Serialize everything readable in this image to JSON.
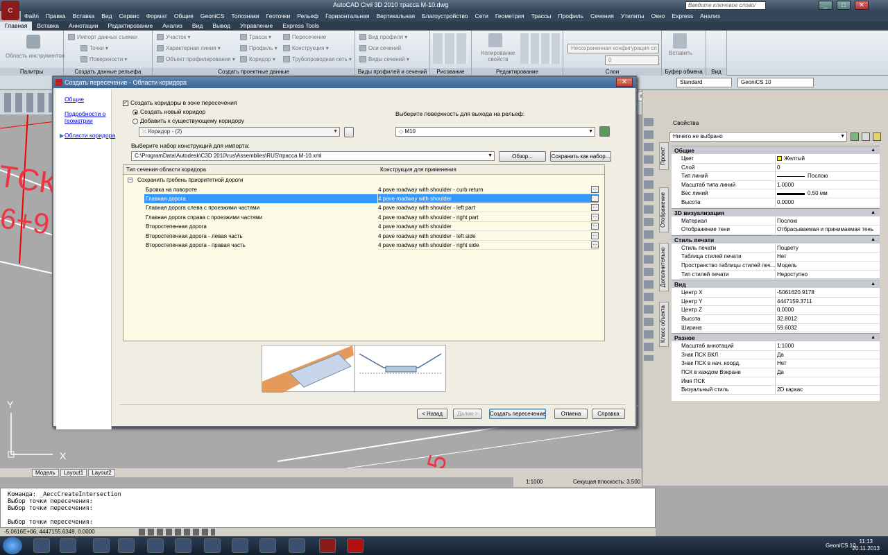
{
  "app": {
    "title": "AutoCAD Civil 3D 2010     трасса M-10.dwg",
    "search_placeholder": "Введите ключевое слово/фразу"
  },
  "menu": [
    "Файл",
    "Правка",
    "Вставка",
    "Вид",
    "Сервис",
    "Формат",
    "Общие",
    "GeoniCS",
    "Топознаки",
    "Геоточки",
    "Рельеф",
    "Горизонтальная",
    "Вертикальная",
    "Благоустройство",
    "Сети",
    "Геометрия",
    "Трассы",
    "Профиль",
    "Сечения",
    "Утилиты",
    "Окно",
    "Express",
    "Анализ"
  ],
  "ribbon_tabs": [
    "Главная",
    "Вставка",
    "Аннотации",
    "Редактирование",
    "Анализ",
    "Вид",
    "Вывод",
    "Управление",
    "Express Tools"
  ],
  "ribbon": {
    "tool_area": "Область инструментов",
    "palettes": "Палитры",
    "create_surface_data": "Создать данные рельефа",
    "import_survey": "Импорт данных съемки",
    "points": "Точки",
    "surfaces": "Поверхности",
    "parcel": "Участок",
    "feature_line": "Характерная линия",
    "grading": "Объект профилирования",
    "alignment": "Трасса",
    "profile": "Профиль",
    "corridor": "Коридор",
    "intersection": "Пересечение",
    "assembly": "Конструкция",
    "pipe_network": "Трубопроводная сеть",
    "create_design_data": "Создать проектные данные",
    "profile_view": "Вид профиля",
    "sample_lines": "Оси сечений",
    "section_views": "Виды сечений",
    "profile_section_views": "Виды профилей и сечений",
    "draw": "Рисование",
    "copy_props": "Копирование свойств",
    "modify": "Редактирование",
    "unsaved_config": "Несохраненная конфигурация сл",
    "layer_zero": "0",
    "layers": "Слои",
    "paste": "Вставить",
    "clipboard": "Буфер обмена",
    "view": "Вид"
  },
  "toolbar": {
    "style1": "Standard",
    "style2": "GeoniCS 10",
    "style3": "ndard"
  },
  "dialog": {
    "title": "Создать пересечение - Области коридора",
    "nav": [
      "Общие",
      "Подробности о геометрии",
      "Области коридора"
    ],
    "create_corridors_label": "Создать коридоры в зоне пересечения",
    "new_corridor_label": "Создать новый коридор",
    "add_existing_label": "Добавить к существующему коридору",
    "corridor_value": "Коридор - (2)",
    "surface_label": "Выберите поверхность для выхода на рельеф:",
    "surface_value": "M10",
    "assembly_set_label": "Выберите набор конструкций для импорта:",
    "assembly_set_path": "C:\\ProgramData\\Autodesk\\C3D 2010\\rus\\Assemblies\\RUS\\трасса M-10.xml",
    "browse_button": "Обзор...",
    "save_as_button": "Сохранить как набор...",
    "col1": "Тип сечения области коридора",
    "col2": "Конструкция для применения",
    "group": "Сохранить гребень приоритетной дороги",
    "rows": [
      {
        "type": "Бровка на повороте",
        "assembly": "4 pave roadway with shoulder - curb return"
      },
      {
        "type": "Главная дорога",
        "assembly": "4 pave roadway with shoulder"
      },
      {
        "type": "Главная дорога слева с проезжими частями",
        "assembly": "4 pave roadway with shoulder - left part"
      },
      {
        "type": "Главная дорога справа с проезжими частями",
        "assembly": "4 pave roadway with shoulder - right part"
      },
      {
        "type": "Второстепенная дорога",
        "assembly": "4 pave roadway with shoulder"
      },
      {
        "type": "Второстепенная дорога - левая часть",
        "assembly": "4 pave roadway with shoulder - left side"
      },
      {
        "type": "Второстепенная дорога - правая часть",
        "assembly": "4 pave roadway with shoulder - right side"
      }
    ],
    "dots": "...",
    "back_button": "< Назад",
    "next_button": "Далее >",
    "create_button": "Создать пересечение",
    "cancel_button": "Отмена",
    "help_button": "Справка"
  },
  "properties": {
    "header": "Свойства",
    "selection": "Ничего не выбрано",
    "tabs": [
      "Проект",
      "Отображение",
      "Дополнительно",
      "Класс объекта"
    ],
    "sections": [
      {
        "name": "Общие",
        "rows": [
          [
            "Цвет",
            "Желтый"
          ],
          [
            "Слой",
            "0"
          ],
          [
            "Тип линий",
            "Послою"
          ],
          [
            "Масштаб типа линий",
            "1.0000"
          ],
          [
            "Вес линий",
            "0.50 мм"
          ],
          [
            "Высота",
            "0.0000"
          ]
        ]
      },
      {
        "name": "3D визуализация",
        "rows": [
          [
            "Материал",
            "Послою"
          ],
          [
            "Отображение тени",
            "Отбрасываемая и принимаемая тень"
          ]
        ]
      },
      {
        "name": "Стиль печати",
        "rows": [
          [
            "Стиль печати",
            "Поцвету"
          ],
          [
            "Таблица стилей печати",
            "Нет"
          ],
          [
            "Пространство таблицы стилей печ...",
            "Модель"
          ],
          [
            "Тип стилей печати",
            "Недоступно"
          ]
        ]
      },
      {
        "name": "Вид",
        "rows": [
          [
            "Центр X",
            "-5061620.9178"
          ],
          [
            "Центр Y",
            "4447159.3711"
          ],
          [
            "Центр Z",
            "0.0000"
          ],
          [
            "Высота",
            "32.8012"
          ],
          [
            "Ширина",
            "59.6032"
          ]
        ]
      },
      {
        "name": "Разное",
        "rows": [
          [
            "Масштаб аннотаций",
            "1:1000"
          ],
          [
            "Знак ПСК ВКЛ",
            "Да"
          ],
          [
            "Знак ПСК в нач. коорд.",
            "Нет"
          ],
          [
            "ПСК в каждом Вэкране",
            "Да"
          ],
          [
            "Имя ПСК",
            ""
          ],
          [
            "Визуальный стиль",
            "2D каркас"
          ]
        ]
      }
    ]
  },
  "layout_tabs": [
    "Модель",
    "Layout1",
    "Layout2"
  ],
  "scale": "1:1000",
  "section_plane": "Секущая плоскость: 3.500",
  "command_lines": [
    "Команда: _AeccCreateIntersection",
    "Выбор точки пересечения:",
    "Выбор точки пересечения:",
    "",
    "Выбор точки пересечения:"
  ],
  "coords": "-5.0616E+06, 4447155.6349, 0.0000",
  "taskbar": {
    "lang": "GeoniCS 10",
    "time": "11:13",
    "date": "20.11.2013"
  },
  "drawing_text": {
    "ucs_y": "Y",
    "ucs_x": "X",
    "tk": "ТСК",
    "num": "6+9",
    "n1": "5"
  }
}
